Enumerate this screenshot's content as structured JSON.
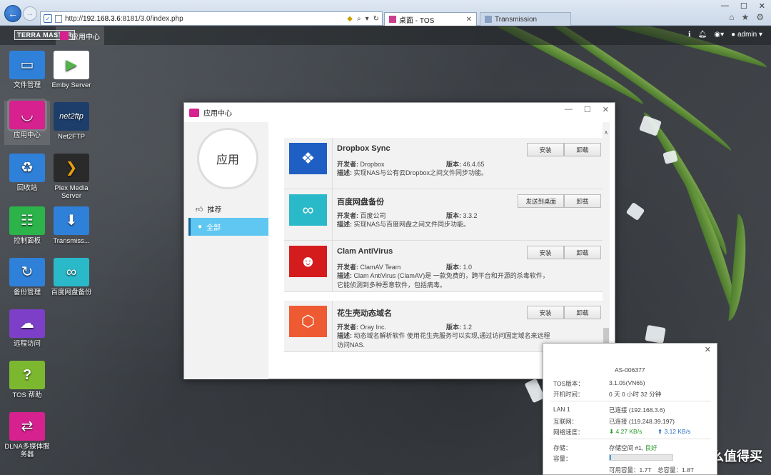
{
  "browser": {
    "url_prefix": "http://",
    "url_host": "192.168.3.6",
    "url_rest": ":8181/3.0/index.php",
    "tabs": [
      {
        "label": "桌面 - TOS"
      },
      {
        "label": "Transmission"
      }
    ]
  },
  "tos": {
    "logo": "TERRA MASTER",
    "taskbar_app": "应用中心",
    "user": "admin"
  },
  "desktop_icons": [
    {
      "label": "文件管理",
      "color": "#2f80d8",
      "glyph": "▭"
    },
    {
      "label": "Emby Server",
      "color": "#ffffff",
      "glyph": "▶"
    },
    {
      "label": "应用中心",
      "color": "#d6218f",
      "glyph": "◡"
    },
    {
      "label": "Net2FTP",
      "color": "#1d3e6b",
      "glyph": "net2ftp"
    },
    {
      "label": "回收站",
      "color": "#2f80d8",
      "glyph": "♻"
    },
    {
      "label": "Plex Media Server",
      "color": "#2a2a2a",
      "glyph": "❯"
    },
    {
      "label": "控制面板",
      "color": "#2cb34a",
      "glyph": "☷"
    },
    {
      "label": "Transmiss...",
      "color": "#2f80d8",
      "glyph": "⬇"
    },
    {
      "label": "备份管理",
      "color": "#2f80d8",
      "glyph": "↻"
    },
    {
      "label": "百度网盘备份",
      "color": "#2ab9c9",
      "glyph": "∞"
    },
    {
      "label": "远程访问",
      "color": "#7d3fc7",
      "glyph": "☁"
    },
    {
      "label": "TOS 帮助",
      "color": "#7cb82f",
      "glyph": "?"
    },
    {
      "label": "DLNA多媒体服务器",
      "color": "#d6218f",
      "glyph": "⇄"
    }
  ],
  "app_center": {
    "title": "应用中心",
    "circle_label": "应用",
    "sidebar": [
      {
        "label": "推荐",
        "icon": "thumbs-up-icon"
      },
      {
        "label": "全部",
        "icon": "user-icon"
      }
    ],
    "partial_text": "...",
    "apps": [
      {
        "name": "Dropbox Sync",
        "dev_label": "开发者:",
        "dev": "Dropbox",
        "ver_label": "版本:",
        "ver": "46.4.65",
        "desc_label": "描述:",
        "desc": "实现NAS与公有云Dropbox之间文件同步功能。",
        "btn1": "安装",
        "btn2": "卸载",
        "color": "#1f5fc4",
        "glyph": "❖"
      },
      {
        "name": "百度网盘备份",
        "dev_label": "开发者:",
        "dev": "百度公司",
        "ver_label": "版本:",
        "ver": "3.3.2",
        "desc_label": "描述:",
        "desc": "实现NAS与百度网盘之间文件同步功能。",
        "btn1": "发送到桌面",
        "btn2": "卸载",
        "color": "#2ab9c9",
        "glyph": "∞"
      },
      {
        "name": "Clam AntiVirus",
        "dev_label": "开发者:",
        "dev": "ClamAV Team",
        "ver_label": "版本:",
        "ver": "1.0",
        "desc_label": "描述:",
        "desc": "Clam AntiVirus (ClamAV)是 一款免费的，跨平台和开源的杀毒软件，它能侦测到多种恶意软件，包括病毒。",
        "btn1": "安装",
        "btn2": "卸载",
        "color": "#d41c1c",
        "glyph": "☻"
      },
      {
        "name": "花生壳动态域名",
        "dev_label": "开发者:",
        "dev": "Oray Inc.",
        "ver_label": "版本:",
        "ver": "1.2",
        "desc_label": "描述:",
        "desc": "动态域名解析软件 使用花生壳服务可以实现,通过访问固定域名来远程访问NAS.",
        "btn1": "安装",
        "btn2": "卸载",
        "color": "#ee5a32",
        "glyph": "⬡"
      }
    ]
  },
  "sysinfo": {
    "device_suffix": "AS-006377",
    "tos_label": "TOS版本：",
    "tos_val": "3.1.05(VN65)",
    "uptime_label": "开机时间：",
    "uptime_val": "0 天 0 小时 32 分钟",
    "lan_label": "LAN 1",
    "lan_val": "已连接 (192.168.3.6)",
    "inet_label": "互联网：",
    "inet_val": "已连接 (119.248.39.197)",
    "speed_label": "网络速度：",
    "down": "4.27 KB/s",
    "up": "3.12 KB/s",
    "storage_label": "存储：",
    "storage_val": "存储空间 #1, ",
    "storage_status": "良好",
    "capacity_label": "容量：",
    "capacity_fraction": 0.02,
    "used_label": "可用容量：1.7T",
    "total_label": "总容量：1.8T"
  },
  "watermark": "值 | 什么值得买"
}
